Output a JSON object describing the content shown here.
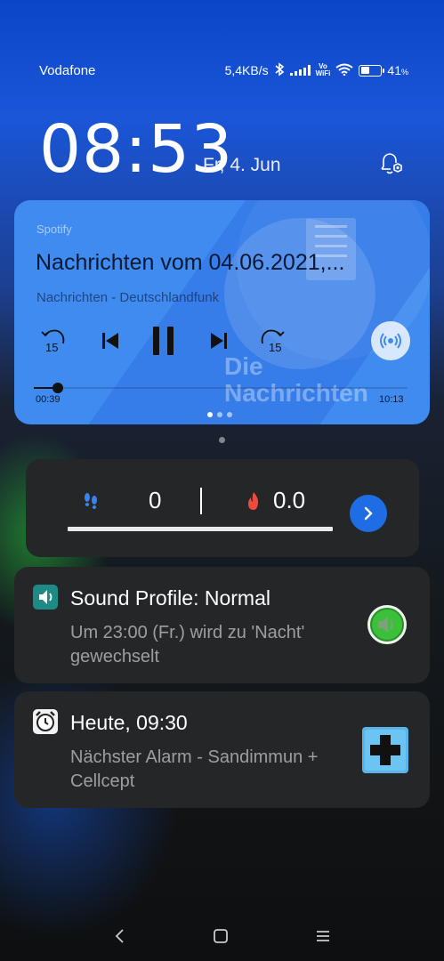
{
  "status_bar": {
    "carrier": "Vodafone",
    "speed": "5,4KB/s",
    "vowifi_top": "Vo",
    "vowifi_bottom": "WiFi",
    "battery_text": "41",
    "battery_unit": "%",
    "battery_level": 0.41
  },
  "lockscreen": {
    "time": "08:53",
    "date": "Fr, 4. Jun"
  },
  "media": {
    "app": "Spotify",
    "title": "Nachrichten vom 04.06.2021,...",
    "artist": "Nachrichten - Deutschlandfunk",
    "artwork_text_1": "Die",
    "artwork_text_2": "Nachrichten",
    "rewind_label": "15",
    "forward_label": "15",
    "elapsed": "00:39",
    "duration": "10:13",
    "progress": 0.064,
    "accent": "#3f8bf0"
  },
  "steps_widget": {
    "steps": "0",
    "calories": "0.0"
  },
  "notifications": [
    {
      "title": "Sound Profile: Normal",
      "body": "Um 23:00 (Fr.) wird zu 'Nacht' gewechselt",
      "icon": "speaker-icon",
      "icon_color": "#1d8a86"
    },
    {
      "title": "Heute, 09:30",
      "body": "Nächster Alarm - Sandimmun + Cellcept",
      "icon": "alarm-clock-icon",
      "action_color": "#5ab4e8"
    }
  ]
}
